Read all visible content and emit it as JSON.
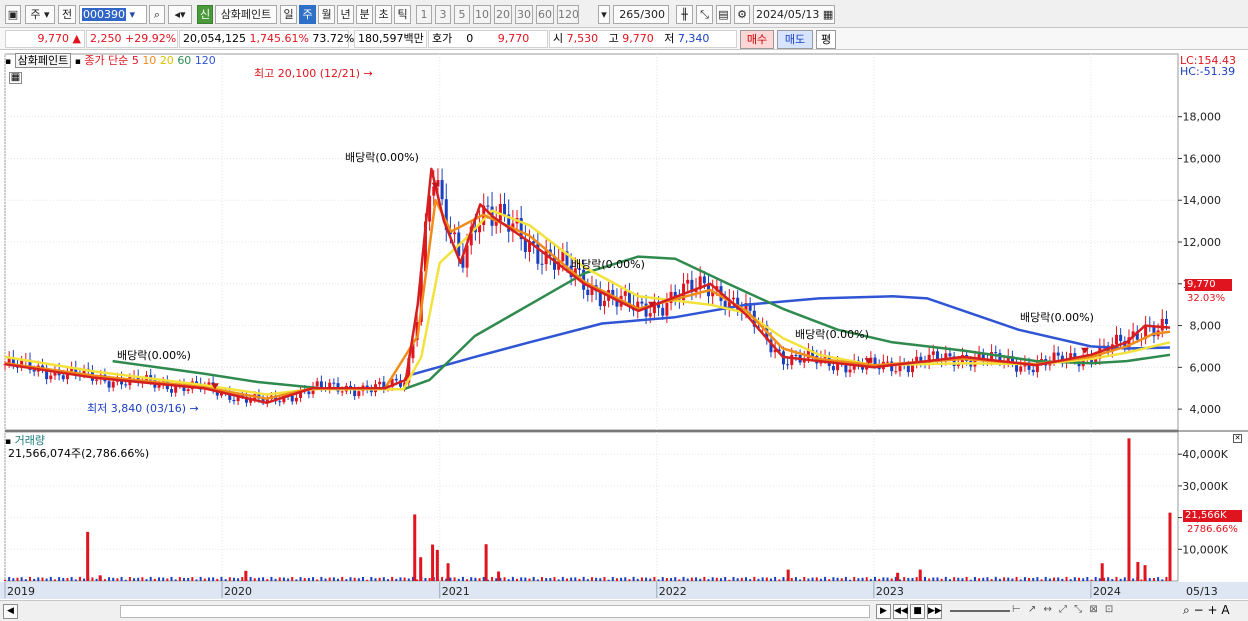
{
  "toolbar": {
    "period": "주",
    "prev_label": "전",
    "code": "000390",
    "new_label": "신",
    "stock_name": "삼화페인트",
    "periods": [
      "일",
      "주",
      "월",
      "년",
      "분",
      "초",
      "틱"
    ],
    "active_period": "주",
    "minute_options": [
      "1",
      "3",
      "5",
      "10",
      "20",
      "30",
      "60",
      "120"
    ],
    "count": "265",
    "count_total": "/300",
    "date": "2024/05/13"
  },
  "info": {
    "price": "9,770",
    "change": "2,250",
    "change_pct": "+29.92%",
    "volume": "20,054,125",
    "volume_pct": "1,745.61%",
    "turnover_pct": "73.72%",
    "amount": "180,597백만",
    "bid_label": "호가",
    "bid_value": "0",
    "bid_price": "9,770",
    "open_label": "시",
    "open": "7,530",
    "high_label": "고",
    "high": "9,770",
    "low_label": "저",
    "low": "7,340",
    "buy_label": "매수",
    "sell_label": "매도",
    "avg_label": "평"
  },
  "price_panel": {
    "title": "삼화페인트",
    "legend_label": "종가 단순",
    "ma_periods": [
      "5",
      "10",
      "20",
      "60",
      "120"
    ],
    "lc_label": "LC:154.43",
    "hc_label": "HC:-51.39",
    "current_price_tag": "9,770",
    "current_pct_tag": "32.03%",
    "high_annotation": "최고 20,100 (12/21)",
    "low_annotation": "최저 3,840 (03/16)",
    "dividend_label": "배당락(0.00%)"
  },
  "volume_panel": {
    "title": "거래량",
    "summary": "21,566,074주(2,786.66%)",
    "current_tag": "21,566K",
    "current_pct_tag": "2786.66%"
  },
  "colors": {
    "candle_up": "#e0141e",
    "candle_down": "#1a3fbf",
    "ma5": "#d42020",
    "ma10": "#f08c1a",
    "ma20": "#f4e23c",
    "ma60": "#2f8a4e",
    "ma120": "#2f55d4",
    "grid": "#e6e6e6"
  },
  "chart_data": [
    {
      "type": "line",
      "title": "삼화페인트",
      "subtitle": "종가 단순 5 10 20 60 120",
      "x_ticks": [
        "2019",
        "2020",
        "2021",
        "2022",
        "2023",
        "2024",
        "05/13"
      ],
      "y_ticks": [
        "4,000",
        "6,000",
        "8,000",
        "10,000",
        "12,000",
        "14,000",
        "16,000",
        "18,000"
      ],
      "ylim": [
        3000,
        21000
      ],
      "xlim": [
        "2019-01-01",
        "2024-05-13"
      ],
      "grid": true,
      "series": [
        {
          "name": "5",
          "points": [
            [
              "2019-01-01",
              6150
            ],
            [
              "2019-06-01",
              5500
            ],
            [
              "2019-12-01",
              5000
            ],
            [
              "2020-03-16",
              4300
            ],
            [
              "2020-06-01",
              5000
            ],
            [
              "2020-10-01",
              5000
            ],
            [
              "2020-11-05",
              5400
            ],
            [
              "2020-11-25",
              9000
            ],
            [
              "2020-12-18",
              15500
            ],
            [
              "2021-01-08",
              13000
            ],
            [
              "2021-02-05",
              11000
            ],
            [
              "2021-03-10",
              13800
            ],
            [
              "2021-04-01",
              13200
            ],
            [
              "2021-06-01",
              12000
            ],
            [
              "2021-09-01",
              10000
            ],
            [
              "2021-12-01",
              8700
            ],
            [
              "2022-04-01",
              10000
            ],
            [
              "2022-06-01",
              8500
            ],
            [
              "2022-08-01",
              6500
            ],
            [
              "2022-10-01",
              6300
            ],
            [
              "2023-01-01",
              6000
            ],
            [
              "2023-06-01",
              6500
            ],
            [
              "2023-10-01",
              6100
            ],
            [
              "2024-01-01",
              6600
            ],
            [
              "2024-03-01",
              7200
            ],
            [
              "2024-04-01",
              8000
            ],
            [
              "2024-05-13",
              7900
            ]
          ]
        },
        {
          "name": "10",
          "points": [
            [
              "2019-01-01",
              6200
            ],
            [
              "2019-06-01",
              5600
            ],
            [
              "2019-12-01",
              5050
            ],
            [
              "2020-03-16",
              4500
            ],
            [
              "2020-06-01",
              5000
            ],
            [
              "2020-10-01",
              5000
            ],
            [
              "2020-11-25",
              7500
            ],
            [
              "2020-12-25",
              14000
            ],
            [
              "2021-01-20",
              12500
            ],
            [
              "2021-03-15",
              13300
            ],
            [
              "2021-06-01",
              12300
            ],
            [
              "2021-09-01",
              10100
            ],
            [
              "2021-12-01",
              8800
            ],
            [
              "2022-04-01",
              9700
            ],
            [
              "2022-06-01",
              8700
            ],
            [
              "2022-08-01",
              6900
            ],
            [
              "2022-10-01",
              6400
            ],
            [
              "2023-01-01",
              6100
            ],
            [
              "2023-06-01",
              6400
            ],
            [
              "2023-10-01",
              6150
            ],
            [
              "2024-01-01",
              6500
            ],
            [
              "2024-03-01",
              7000
            ],
            [
              "2024-04-15",
              7600
            ],
            [
              "2024-05-13",
              7700
            ]
          ]
        },
        {
          "name": "20",
          "points": [
            [
              "2019-01-01",
              6500
            ],
            [
              "2019-06-01",
              5800
            ],
            [
              "2019-12-01",
              5150
            ],
            [
              "2020-03-16",
              4700
            ],
            [
              "2020-06-01",
              4950
            ],
            [
              "2020-11-01",
              4950
            ],
            [
              "2020-12-01",
              6500
            ],
            [
              "2021-01-01",
              11000
            ],
            [
              "2021-02-15",
              12200
            ],
            [
              "2021-03-30",
              13500
            ],
            [
              "2021-06-01",
              12800
            ],
            [
              "2021-09-01",
              10800
            ],
            [
              "2021-12-01",
              9400
            ],
            [
              "2022-04-01",
              9000
            ],
            [
              "2022-06-01",
              8600
            ],
            [
              "2022-08-01",
              7400
            ],
            [
              "2022-10-01",
              6600
            ],
            [
              "2023-01-01",
              6100
            ],
            [
              "2023-06-01",
              6200
            ],
            [
              "2023-10-01",
              6150
            ],
            [
              "2024-01-01",
              6400
            ],
            [
              "2024-03-01",
              6700
            ],
            [
              "2024-05-13",
              7200
            ]
          ]
        },
        {
          "name": "60",
          "points": [
            [
              "2019-07-01",
              6300
            ],
            [
              "2019-12-01",
              5700
            ],
            [
              "2020-03-01",
              5300
            ],
            [
              "2020-07-01",
              4950
            ],
            [
              "2020-11-01",
              4950
            ],
            [
              "2020-12-15",
              5400
            ],
            [
              "2021-03-01",
              7500
            ],
            [
              "2021-06-01",
              9000
            ],
            [
              "2021-09-01",
              10500
            ],
            [
              "2021-12-01",
              11300
            ],
            [
              "2022-02-01",
              11200
            ],
            [
              "2022-05-01",
              10000
            ],
            [
              "2022-08-01",
              8800
            ],
            [
              "2022-11-01",
              7800
            ],
            [
              "2023-02-01",
              7200
            ],
            [
              "2023-06-01",
              6800
            ],
            [
              "2023-10-01",
              6300
            ],
            [
              "2024-01-01",
              6200
            ],
            [
              "2024-03-01",
              6300
            ],
            [
              "2024-05-13",
              6600
            ]
          ]
        },
        {
          "name": "120",
          "points": [
            [
              "2020-11-15",
              5650
            ],
            [
              "2021-03-01",
              6500
            ],
            [
              "2021-06-01",
              7200
            ],
            [
              "2021-10-01",
              8100
            ],
            [
              "2022-02-01",
              8400
            ],
            [
              "2022-06-01",
              9000
            ],
            [
              "2022-10-01",
              9300
            ],
            [
              "2023-02-01",
              9400
            ],
            [
              "2023-04-01",
              9300
            ],
            [
              "2023-09-01",
              7800
            ],
            [
              "2024-01-01",
              7000
            ],
            [
              "2024-03-01",
              6900
            ],
            [
              "2024-05-13",
              6950
            ]
          ]
        }
      ]
    },
    {
      "type": "bar",
      "title": "거래량",
      "y_ticks": [
        "10,000K",
        "20,000K",
        "30,000K",
        "40,000K"
      ],
      "ylim": [
        0,
        47000
      ],
      "bars": [
        [
          "2019-05-20",
          15500
        ],
        [
          "2019-06-10",
          1800
        ],
        [
          "2020-02-10",
          3200
        ],
        [
          "2020-11-20",
          21000
        ],
        [
          "2020-11-30",
          7500
        ],
        [
          "2020-12-20",
          11500
        ],
        [
          "2020-12-28",
          9800
        ],
        [
          "2021-01-15",
          5600
        ],
        [
          "2021-03-20",
          11600
        ],
        [
          "2021-04-10",
          3000
        ],
        [
          "2022-08-10",
          3600
        ],
        [
          "2023-02-10",
          2600
        ],
        [
          "2023-03-20",
          3600
        ],
        [
          "2024-01-20",
          5600
        ],
        [
          "2024-03-05",
          45000
        ],
        [
          "2024-03-20",
          6000
        ],
        [
          "2024-04-01",
          5000
        ],
        [
          "2024-05-13",
          21566
        ]
      ]
    }
  ]
}
